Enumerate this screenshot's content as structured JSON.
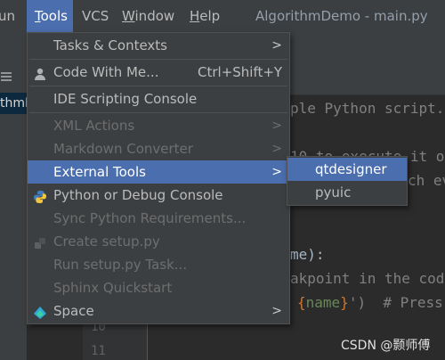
{
  "menubar": {
    "items": [
      {
        "label": "Run",
        "underline": "R",
        "rest": "un"
      },
      {
        "label": "Tools",
        "underline": "T",
        "rest": "ools"
      },
      {
        "label": "VCS",
        "underline": "",
        "rest": "VCS"
      },
      {
        "label": "Window",
        "underline": "W",
        "rest": "indow"
      },
      {
        "label": "Help",
        "underline": "H",
        "rest": "elp"
      }
    ],
    "window_title": "AlgorithmDemo - main.py"
  },
  "project": {
    "selected_label": "thmD"
  },
  "gutter": {
    "line_numbers": [
      "10",
      "11"
    ]
  },
  "code": {
    "line1": "ple Python script.",
    "line2": "10 to execute it o",
    "line3": "ch ev",
    "line4": "me):",
    "line5": "akpoint in the cod",
    "line6_brace_open": "{",
    "line6_name": "name",
    "line6_brace_close": "}",
    "line6_rest": "')  # Press"
  },
  "tools_menu": {
    "items": [
      {
        "label": "Tasks & Contexts",
        "has_submenu": true,
        "enabled": true
      },
      {
        "label": "Code With Me...",
        "shortcut": "Ctrl+Shift+Y",
        "icon": "person-icon",
        "enabled": true
      },
      {
        "label": "IDE Scripting Console",
        "enabled": true
      },
      {
        "label": "XML Actions",
        "has_submenu": true,
        "enabled": false
      },
      {
        "label": "Markdown Converter",
        "has_submenu": true,
        "enabled": false
      },
      {
        "label": "External Tools",
        "has_submenu": true,
        "enabled": true,
        "selected": true
      },
      {
        "label": "Python or Debug Console",
        "icon": "python-icon",
        "enabled": true
      },
      {
        "label": "Sync Python Requirements...",
        "enabled": false
      },
      {
        "label": "Create setup.py",
        "icon": "setup-icon",
        "enabled": false
      },
      {
        "label": "Run setup.py Task...",
        "enabled": false
      },
      {
        "label": "Sphinx Quickstart",
        "enabled": false
      },
      {
        "label": "Space",
        "has_submenu": true,
        "icon": "space-icon",
        "enabled": true
      }
    ],
    "submenu_arrow": ">"
  },
  "external_tools_submenu": {
    "items": [
      {
        "label": "qtdesigner",
        "selected": true
      },
      {
        "label": "pyuic",
        "selected": false
      }
    ]
  },
  "watermark": "CSDN @颢师傅",
  "colors": {
    "selection": "#4b6eaf",
    "menu_bg": "#3c3f41",
    "editor_bg": "#2b2b2b",
    "disabled_text": "#6e6e6e"
  }
}
